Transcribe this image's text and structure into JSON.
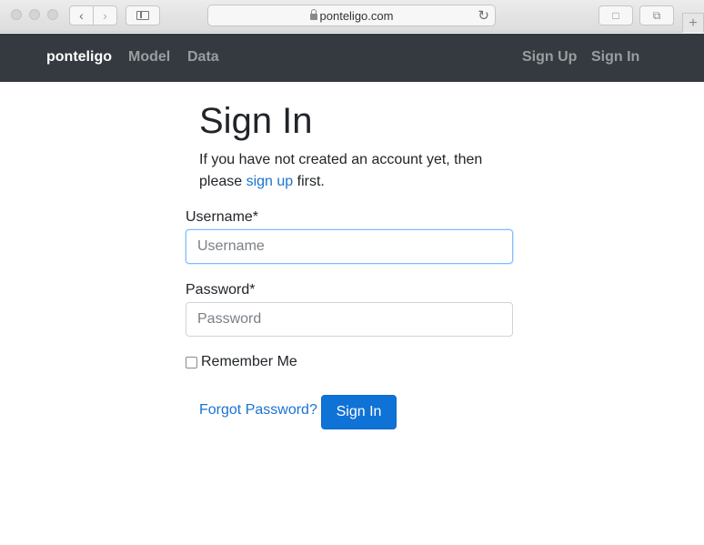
{
  "browser": {
    "url": "ponteligo.com",
    "icons": [
      "back-icon",
      "forward-icon",
      "sidebar-icon",
      "lock-icon",
      "reload-icon",
      "share-icon",
      "tabs-icon",
      "plus-icon"
    ]
  },
  "navbar": {
    "brand": "ponteligo",
    "links": [
      "Model",
      "Data"
    ],
    "right_links": [
      "Sign Up",
      "Sign In"
    ],
    "bg_color": "#343a40"
  },
  "main": {
    "title": "Sign In",
    "intro_before": "If you have not created an account yet, then please ",
    "intro_link": "sign up",
    "intro_after": " first.",
    "username_label": "Username*",
    "username_placeholder": "Username",
    "password_label": "Password*",
    "password_placeholder": "Password",
    "remember_label": "Remember Me",
    "forgot_link": "Forgot Password?",
    "submit_label": "Sign In",
    "accent_color": "#0f72d6"
  }
}
